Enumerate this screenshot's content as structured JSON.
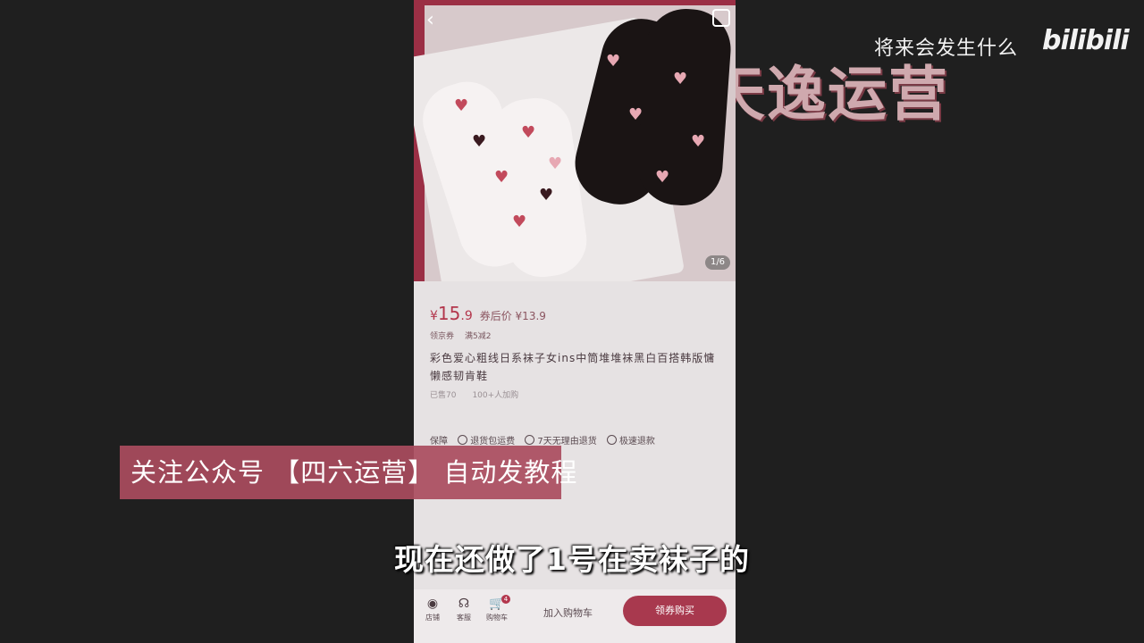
{
  "watermark": {
    "title": "将来会发生什么",
    "logo": "bilibili",
    "author": "@天逸运营"
  },
  "phone": {
    "image_pager": "1/6",
    "price": {
      "symbol": "¥",
      "main": "15",
      "decimal": ".9",
      "after_coupon": "券后价 ¥13.9"
    },
    "coupons": [
      "领京券",
      "满5减2"
    ],
    "title": "彩色爱心粗线日系袜子女ins中筒堆堆袜黑白百搭韩版慵懒感韧肯鞋",
    "sales": [
      "已售70",
      "100+人加购"
    ],
    "guarantee": {
      "label": "保障",
      "items": [
        "退货包运费",
        "7天无理由退货",
        "极速退款"
      ]
    },
    "bottom": {
      "shop": "店铺",
      "service": "客服",
      "cart": "购物车",
      "cart_count": "4",
      "add_cart": "加入购物车",
      "buy": "领券购买"
    }
  },
  "banner": "关注公众号 【四六运营】 自动发教程",
  "subtitle": "现在还做了1号在卖袜子的",
  "colors": {
    "background": "#1f1f1f",
    "accent": "#a8394e",
    "banner": "#aa4c5e"
  }
}
